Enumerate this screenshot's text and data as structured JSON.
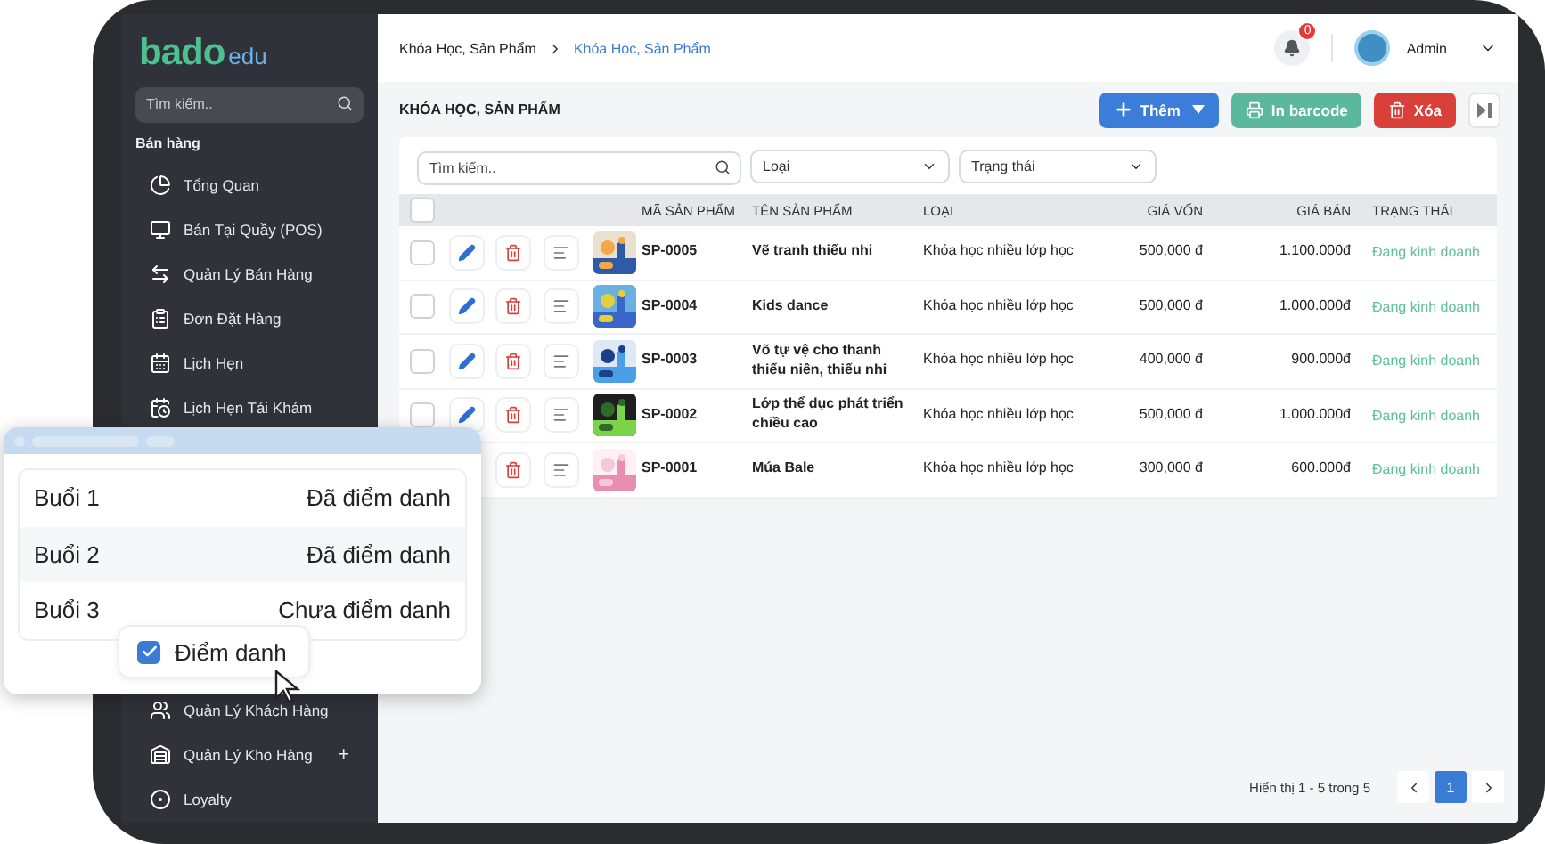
{
  "sidebar": {
    "logo": {
      "brand": "bado",
      "suffix": "edu"
    },
    "search": {
      "placeholder": "Tìm kiếm.."
    },
    "section": "Bán hàng",
    "items": [
      {
        "label": "Tổng Quan"
      },
      {
        "label": "Bán Tại Quầy (POS)"
      },
      {
        "label": "Quản Lý Bán Hàng"
      },
      {
        "label": "Đơn Đặt Hàng"
      },
      {
        "label": "Lịch Hẹn"
      },
      {
        "label": "Lịch Hẹn Tái Khám"
      }
    ],
    "bottom_items": [
      {
        "label": "Quản Lý Khách Hàng"
      },
      {
        "label": "Quản Lý Kho Hàng",
        "expand_symbol": "+"
      },
      {
        "label": "Loyalty"
      }
    ]
  },
  "header": {
    "breadcrumb": [
      {
        "label": "Khóa Học, Sản Phẩm",
        "current": false
      },
      {
        "label": "Khóa Học, Sản Phẩm",
        "current": true
      }
    ],
    "notifications": "0",
    "user": "Admin"
  },
  "toolbar": {
    "title": "KHÓA HỌC, SẢN PHẨM",
    "buttons": [
      {
        "label": "Thêm",
        "kind": "add"
      },
      {
        "label": "In barcode",
        "kind": "print"
      },
      {
        "label": "Xóa",
        "kind": "delete"
      }
    ]
  },
  "filters": {
    "search": {
      "placeholder": "Tìm kiếm.."
    },
    "selects": [
      "Loại",
      "Trạng thái"
    ]
  },
  "table": {
    "select_all": {
      "checked": false
    },
    "columns": [
      "MÃ SẢN PHẨM",
      "TÊN SẢN PHẨM",
      "LOẠI",
      "GIÁ VỐN",
      "GIÁ BÁN",
      "TRẠNG THÁI"
    ],
    "rows": [
      {
        "checked": false,
        "code": "SP-0005",
        "name": "Vẽ tranh thiếu nhi",
        "type": "Khóa học nhiều lớp học",
        "cost": "500,000 đ",
        "price": "1.100.000đ",
        "status": "Đang kinh doanh"
      },
      {
        "checked": false,
        "code": "SP-0004",
        "name": "Kids dance",
        "type": "Khóa học nhiều lớp học",
        "cost": "500,000 đ",
        "price": "1.000.000đ",
        "status": "Đang kinh doanh"
      },
      {
        "checked": false,
        "code": "SP-0003",
        "name": "Võ tự vệ cho thanh thiếu niên, thiếu nhi",
        "type": "Khóa học nhiều lớp học",
        "cost": "400,000 đ",
        "price": "900.000đ",
        "status": "Đang kinh doanh"
      },
      {
        "checked": false,
        "code": "SP-0002",
        "name": "Lớp thể dục phát triển chiều cao",
        "type": "Khóa học nhiều lớp học",
        "cost": "500,000 đ",
        "price": "1.000.000đ",
        "status": "Đang kinh doanh"
      },
      {
        "code": "SP-0001",
        "name": "Múa Bale",
        "type": "Khóa học nhiều lớp học",
        "cost": "300,000 đ",
        "price": "600.000đ",
        "status": "Đang kinh doanh"
      }
    ]
  },
  "pagination": {
    "summary": "Hiển thị 1 - 5 trong 5",
    "pages": [
      {
        "label": "1",
        "selected": true
      }
    ]
  },
  "overlay": {
    "sessions": [
      {
        "name": "Buổi 1",
        "status": "Đã điểm danh"
      },
      {
        "name": "Buổi 2",
        "status": "Đã điểm danh"
      },
      {
        "name": "Buổi 3",
        "status": "Chưa điểm danh"
      }
    ],
    "action": {
      "label": "Điểm danh",
      "checked": true
    }
  }
}
